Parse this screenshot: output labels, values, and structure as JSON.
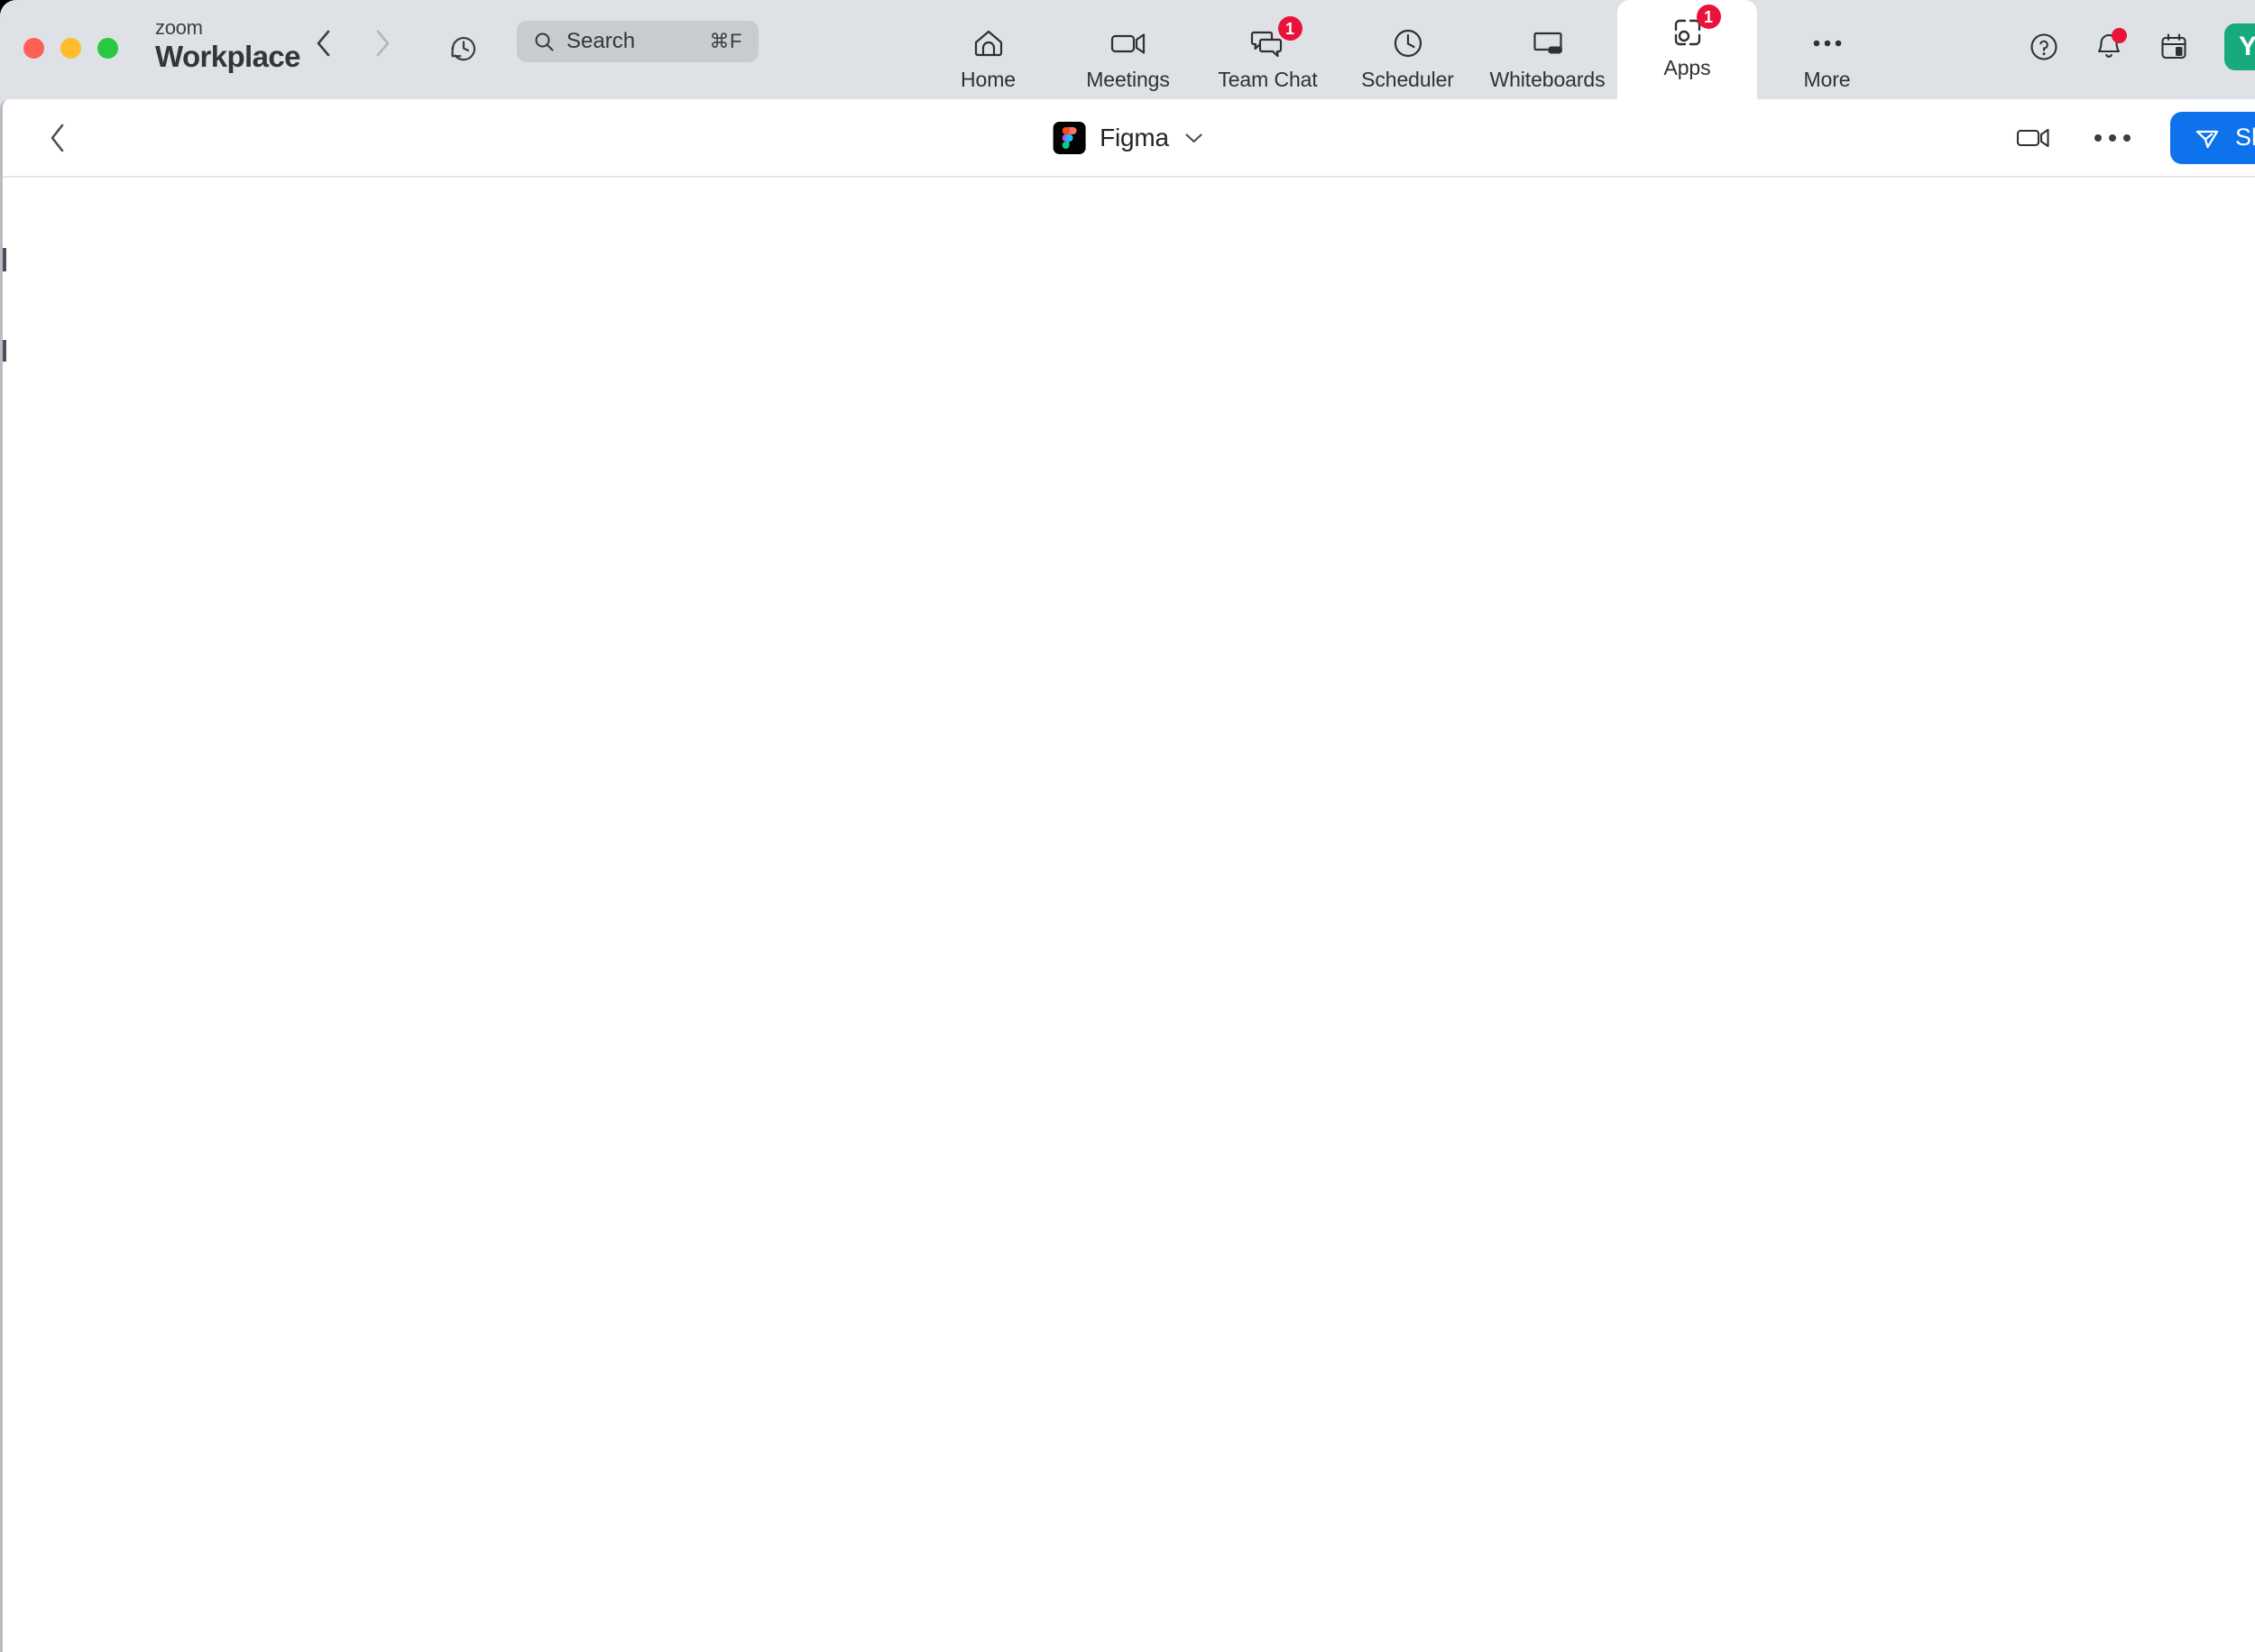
{
  "window": {
    "traffic_lights": [
      {
        "name": "close",
        "color": "#ff5f57"
      },
      {
        "name": "minimize",
        "color": "#febc2e"
      },
      {
        "name": "maximize",
        "color": "#28c840"
      }
    ]
  },
  "brand": {
    "line1": "zoom",
    "line2": "Workplace"
  },
  "nav": {
    "back_icon": "chevron-left-icon",
    "forward_icon": "chevron-right-icon",
    "history_icon": "history-clock-icon"
  },
  "search": {
    "placeholder": "Search",
    "shortcut": "⌘F"
  },
  "tabs": [
    {
      "label": "Home",
      "icon": "home-icon",
      "badge": null,
      "active": false
    },
    {
      "label": "Meetings",
      "icon": "video-camera-icon",
      "badge": null,
      "active": false
    },
    {
      "label": "Team Chat",
      "icon": "chat-bubbles-icon",
      "badge": "1",
      "active": false
    },
    {
      "label": "Scheduler",
      "icon": "clock-icon",
      "badge": null,
      "active": false
    },
    {
      "label": "Whiteboards",
      "icon": "whiteboard-icon",
      "badge": null,
      "active": false
    },
    {
      "label": "Apps",
      "icon": "apps-icon",
      "badge": "1",
      "active": true
    },
    {
      "label": "More",
      "icon": "ellipsis-icon",
      "badge": null,
      "active": false
    }
  ],
  "title_right": {
    "help_icon": "help-circle-icon",
    "notifications_icon": "bell-icon",
    "notifications_has_alert": true,
    "calendar_icon": "calendar-icon",
    "avatar_initial": "Y",
    "avatar_color": "#18a97f"
  },
  "app": {
    "back_icon": "chevron-left-icon",
    "title": "Figma",
    "title_dropdown_icon": "chevron-down-icon",
    "video_icon": "video-camera-icon",
    "more_icon": "ellipsis-icon",
    "share_label": "Share",
    "share_icon": "send-plane-icon",
    "share_color": "#0e72ed"
  },
  "colors": {
    "chrome_background": "#dee1e6",
    "panel_background": "#ffffff",
    "search_background": "#c8ccd1",
    "badge_red": "#e8133a",
    "accent_blue": "#0e72ed"
  }
}
